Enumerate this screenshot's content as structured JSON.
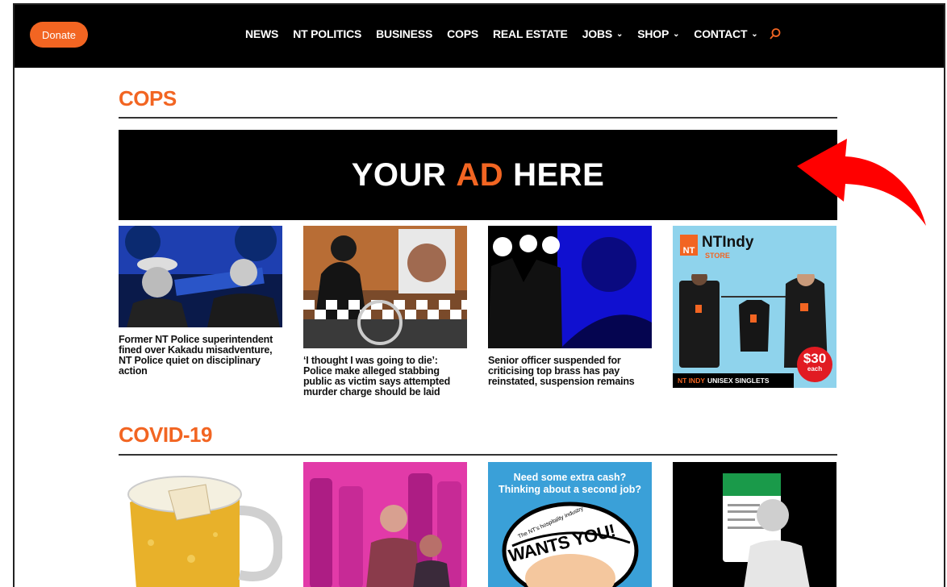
{
  "header": {
    "donate_label": "Donate",
    "nav": [
      {
        "label": "NEWS",
        "dropdown": false
      },
      {
        "label": "NT POLITICS",
        "dropdown": false
      },
      {
        "label": "BUSINESS",
        "dropdown": false
      },
      {
        "label": "COPS",
        "dropdown": false
      },
      {
        "label": "REAL ESTATE",
        "dropdown": false
      },
      {
        "label": "JOBS",
        "dropdown": true
      },
      {
        "label": "SHOP",
        "dropdown": true
      },
      {
        "label": "CONTACT",
        "dropdown": true
      }
    ],
    "search_icon": "search-icon"
  },
  "sections": {
    "cops": {
      "title": "COPS",
      "ad": {
        "part1": "YOUR",
        "part2": "AD",
        "part3": "HERE"
      },
      "articles": [
        {
          "headline": "Former NT Police superintendent fined over Kakadu misadventure, NT Police quiet on disciplinary action"
        },
        {
          "headline": "‘I thought I was going to die’: Police make alleged stabbing public as victim says attempted murder charge should be laid"
        },
        {
          "headline": "Senior officer suspended for criticising top brass has pay reinstated, suspension remains"
        }
      ],
      "store_ad": {
        "brand_nt": "NT",
        "brand_name": "NTIndy",
        "brand_sub": "STORE",
        "price": "$30",
        "price_sub": "each",
        "footer_a": "NT INDY",
        "footer_b": "UNISEX SINGLETS"
      }
    },
    "covid": {
      "title": "COVID-19",
      "jobs_ad_line1": "Need some extra cash?",
      "jobs_ad_line2": "Thinking about a second job?",
      "jobs_ad_badge": "WANTS YOU!",
      "jobs_ad_small": "The NT's hospitality industry"
    }
  },
  "colors": {
    "accent": "#f26522",
    "bar": "#000000",
    "arrow": "#ff0000"
  }
}
